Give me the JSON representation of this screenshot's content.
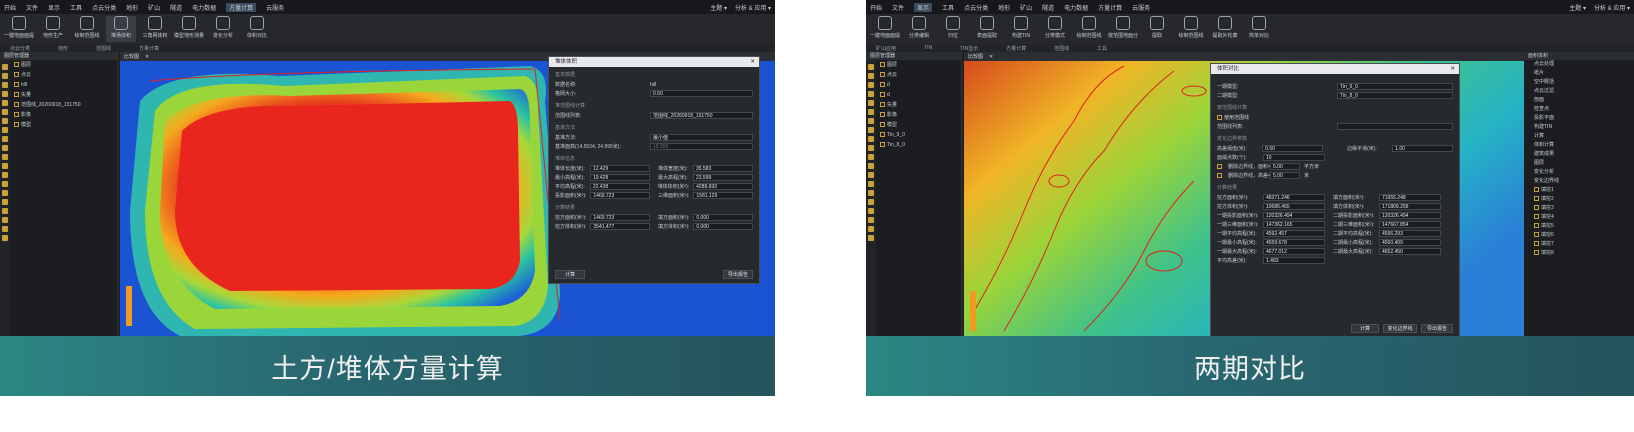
{
  "left": {
    "menu": [
      "开始",
      "文件",
      "显示",
      "工具",
      "点云分类",
      "地形",
      "矿山",
      "隧道",
      "电力数据",
      "方量计算",
      "云服务"
    ],
    "menu_active_index": 9,
    "menu_right": [
      "主题 ▾",
      "分析 & 应用 ▾"
    ],
    "ribbon": [
      "一键地面面提",
      "地形生产",
      "绘制范围线",
      "堆场体积",
      "三角网体积",
      "模型地形测量",
      "变化分析",
      "体积对比"
    ],
    "groups": [
      "点云分类",
      "地形",
      "范围线",
      "方量计算"
    ],
    "tab": "比较图",
    "panel_title": "图层管理器",
    "tree": [
      "图层",
      "点云",
      "hill",
      "矢量",
      "范围线_20260918_151750",
      "影像",
      "模型"
    ],
    "dialog": {
      "title": "堆体体积",
      "sec1": "基本数据",
      "name_label": "数据名称:",
      "name_value": "hill",
      "grid_label": "格网大小:",
      "grid_value": "0.50",
      "sec2": "堆范围线计算",
      "range_label": "范围线列表:",
      "range_value": "范围线_20260918_151750",
      "sec3": "基准方法",
      "method_label": "基准方法:",
      "method_value": "最小值",
      "elev_label": "基准面高(14.5534, 24.995米):",
      "elev_value": "18.555",
      "sec4": "堆体信息",
      "pairs": [
        [
          "堆体长度(米):",
          "12.429",
          "堆体宽度(米):",
          "35.583"
        ],
        [
          "最小高程(米):",
          "19.428",
          "最大高程(米):",
          "23.599"
        ],
        [
          "平均高程(米):",
          "22.438",
          "堆体体积(米³):",
          "4288.693"
        ],
        [
          "投影面积(米²):",
          "1469.723",
          "三维面积(米²):",
          "1581.129"
        ]
      ],
      "sec5": "计算结果",
      "results": [
        [
          "挖方面积(米²):",
          "1469.723",
          "填方面积(米²):",
          "0.000"
        ],
        [
          "挖方体积(米³):",
          "3541.477",
          "填方体积(米³):",
          "0.000"
        ]
      ],
      "btn_calc": "计算",
      "btn_export": "导出报告"
    },
    "caption": "土方/堆体方量计算"
  },
  "right": {
    "menu": [
      "开始",
      "文件",
      "显示",
      "工具",
      "点云分类",
      "地形",
      "矿山",
      "隧道",
      "电力数据",
      "方量计算",
      "云服务"
    ],
    "menu_active_index": 2,
    "menu_right": [
      "主题 ▾",
      "分析 & 应用 ▾"
    ],
    "ribbon": [
      "一键地面面提",
      "分类编辑",
      "归位",
      "表面提取",
      "构建TIN",
      "分类模式",
      "绘制范围线",
      "按范围地面分",
      "提取",
      "绘制范围线",
      "提取外轮廓",
      "简单对比"
    ],
    "groups": [
      "矿山应用",
      "TIN",
      "TIN显示",
      "方量计算",
      "范围线",
      "工具"
    ],
    "tab": "比较图",
    "panel_title": "图层管理器",
    "tree": [
      "图层",
      "点云",
      "d",
      "d",
      "矢量",
      "影像",
      "模型",
      "Tin_9_0",
      "Tin_8_0"
    ],
    "rpanel_title": "面积体积",
    "rpanel": [
      "点云处理",
      "纸片",
      "空中概括",
      "点云过滤",
      "剖面",
      "检查点",
      "投影平面",
      "构建TIN",
      "计算",
      "体积计算",
      "建筑成果",
      "图层",
      "变化分析",
      "变化边界线",
      "填挖1",
      "填挖2",
      "填挖3",
      "填挖4",
      "填挖5",
      "填挖6",
      "填挖7",
      "填挖8"
    ],
    "dialog": {
      "title": "体积对比",
      "t1_label": "一期模型:",
      "t1_value": "Tin_9_0",
      "t2_label": "二期模型:",
      "t2_value": "Tin_8_0",
      "sec2": "按范围线计算",
      "use_range": "使用范围线",
      "range_label": "范围线列表:",
      "sec3": "变化边界参数",
      "thr_label": "高差阈值(米):",
      "thr_value": "0.50",
      "buf_label": "边缘平滑(米):",
      "buf_value": "1.00",
      "cnt_label": "面域点数(个):",
      "cnt_value": "10",
      "opt1": "删除边界线，面积<",
      "opt1_value": "5.00",
      "opt1_unit": "平方米",
      "opt2": "删除边界线，高差<",
      "opt2_value": "5.00",
      "opt2_unit": "米",
      "sec4": "计算结果",
      "pairs": [
        [
          "挖方面积(米²):",
          "48371.246",
          "填方面积(米²):",
          "71955.248"
        ],
        [
          "挖方体积(米³):",
          "10686.465",
          "填方体积(米³):",
          "171809.299"
        ],
        [
          "一期投影面积(米²):",
          "120326.494",
          "二期投影面积(米²):",
          "120326.494"
        ],
        [
          "一期三维面积(米²):",
          "147362.165",
          "二期三维面积(米²):",
          "147667.854"
        ],
        [
          "一期平均高程(米):",
          "4592.457",
          "二期平均高程(米):",
          "4596.293"
        ],
        [
          "一期最小高程(米):",
          "4559.678",
          "二期最小高程(米):",
          "4560.409"
        ],
        [
          "一期最大高程(米):",
          "4677.012",
          "二期最大高程(米):",
          "4652.450"
        ]
      ],
      "avg_label": "平均高差(米):",
      "avg_value": "1.483",
      "btn_calc": "计算",
      "btn_border": "变化边界线",
      "btn_export": "导出报告"
    },
    "caption": "两期对比"
  }
}
